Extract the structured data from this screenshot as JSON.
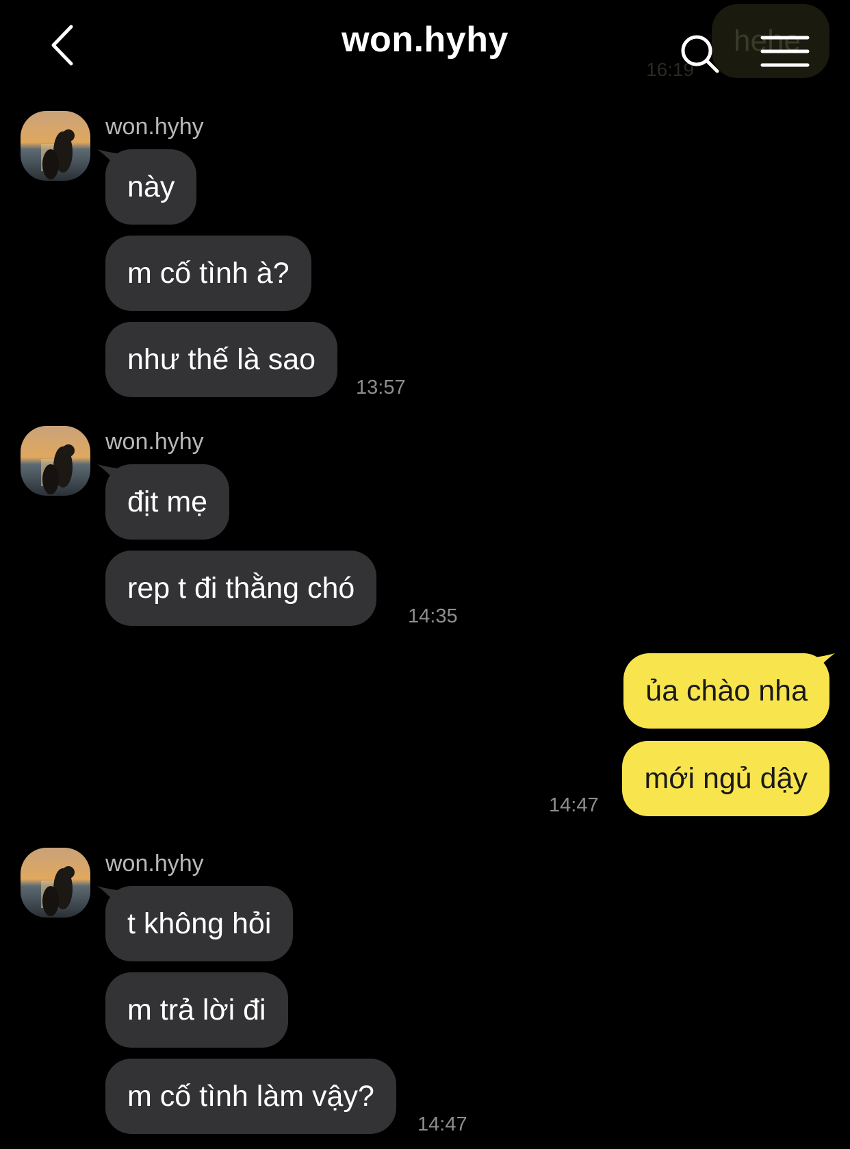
{
  "header": {
    "title": "won.hyhy",
    "ghost_bubble_text": "hehe",
    "ghost_time": "16:19"
  },
  "colors": {
    "background": "#000000",
    "incoming_bubble": "#333335",
    "outgoing_bubble": "#f8e54e",
    "timestamp": "#8e8e8e"
  },
  "groups": [
    {
      "sender": "won.hyhy",
      "messages": [
        "này",
        "m cố tình à?",
        "như thế là sao"
      ],
      "time": "13:57"
    },
    {
      "sender": "won.hyhy",
      "messages": [
        "địt mẹ",
        "rep t đi thằng chó"
      ],
      "time": "14:35"
    },
    {
      "sender": "me",
      "messages": [
        "ủa chào nha",
        "mới ngủ dậy"
      ],
      "time": "14:47"
    },
    {
      "sender": "won.hyhy",
      "messages": [
        "t không hỏi",
        "m trả lời đi",
        "m cố tình làm vậy?"
      ],
      "time": "14:47"
    }
  ]
}
